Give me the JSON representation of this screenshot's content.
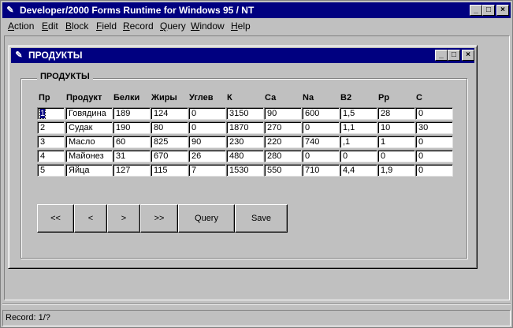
{
  "app": {
    "title": "Developer/2000 Forms Runtime for Windows 95 / NT",
    "icon": "forms-app-icon"
  },
  "title_controls": {
    "minimize": "_",
    "maximize": "□",
    "close": "×"
  },
  "menu": [
    {
      "label": "Action",
      "key": "A",
      "rest": "ction"
    },
    {
      "label": "Edit",
      "key": "E",
      "rest": "dit"
    },
    {
      "label": "Block",
      "key": "B",
      "rest": "lock"
    },
    {
      "label": "Field",
      "key": "F",
      "rest": "ield"
    },
    {
      "label": "Record",
      "key": "R",
      "rest": "ecord"
    },
    {
      "label": "Query",
      "key": "Q",
      "rest": "uery"
    },
    {
      "label": "Window",
      "key": "W",
      "rest": "indow"
    },
    {
      "label": "Help",
      "key": "H",
      "rest": "elp"
    }
  ],
  "child_window": {
    "title": "ПРОДУКТЫ"
  },
  "group": {
    "label": "ПРОДУКТЫ"
  },
  "columns": [
    "Пр",
    "Продукт",
    "Белки",
    "Жиры",
    "Углев",
    "К",
    "Са",
    "Na",
    "B2",
    "Pp",
    "C"
  ],
  "rows": [
    [
      "1",
      "Говядина",
      "189",
      "124",
      "0",
      "3150",
      "90",
      "600",
      "1,5",
      "28",
      "0"
    ],
    [
      "2",
      "Судак",
      "190",
      "80",
      "0",
      "1870",
      "270",
      "0",
      "1,1",
      "10",
      "30"
    ],
    [
      "3",
      "Масло",
      "60",
      "825",
      "90",
      "230",
      "220",
      "740",
      ",1",
      "1",
      "0"
    ],
    [
      "4",
      "Майонез",
      "31",
      "670",
      "26",
      "480",
      "280",
      "0",
      "0",
      "0",
      "0"
    ],
    [
      "5",
      "Яйца",
      "127",
      "115",
      "7",
      "1530",
      "550",
      "710",
      "4,4",
      "1,9",
      "0"
    ]
  ],
  "buttons": {
    "first": "<<",
    "prev": "<",
    "next": ">",
    "last": ">>",
    "query": "Query",
    "save": "Save"
  },
  "status": {
    "text": "Record: 1/?"
  }
}
